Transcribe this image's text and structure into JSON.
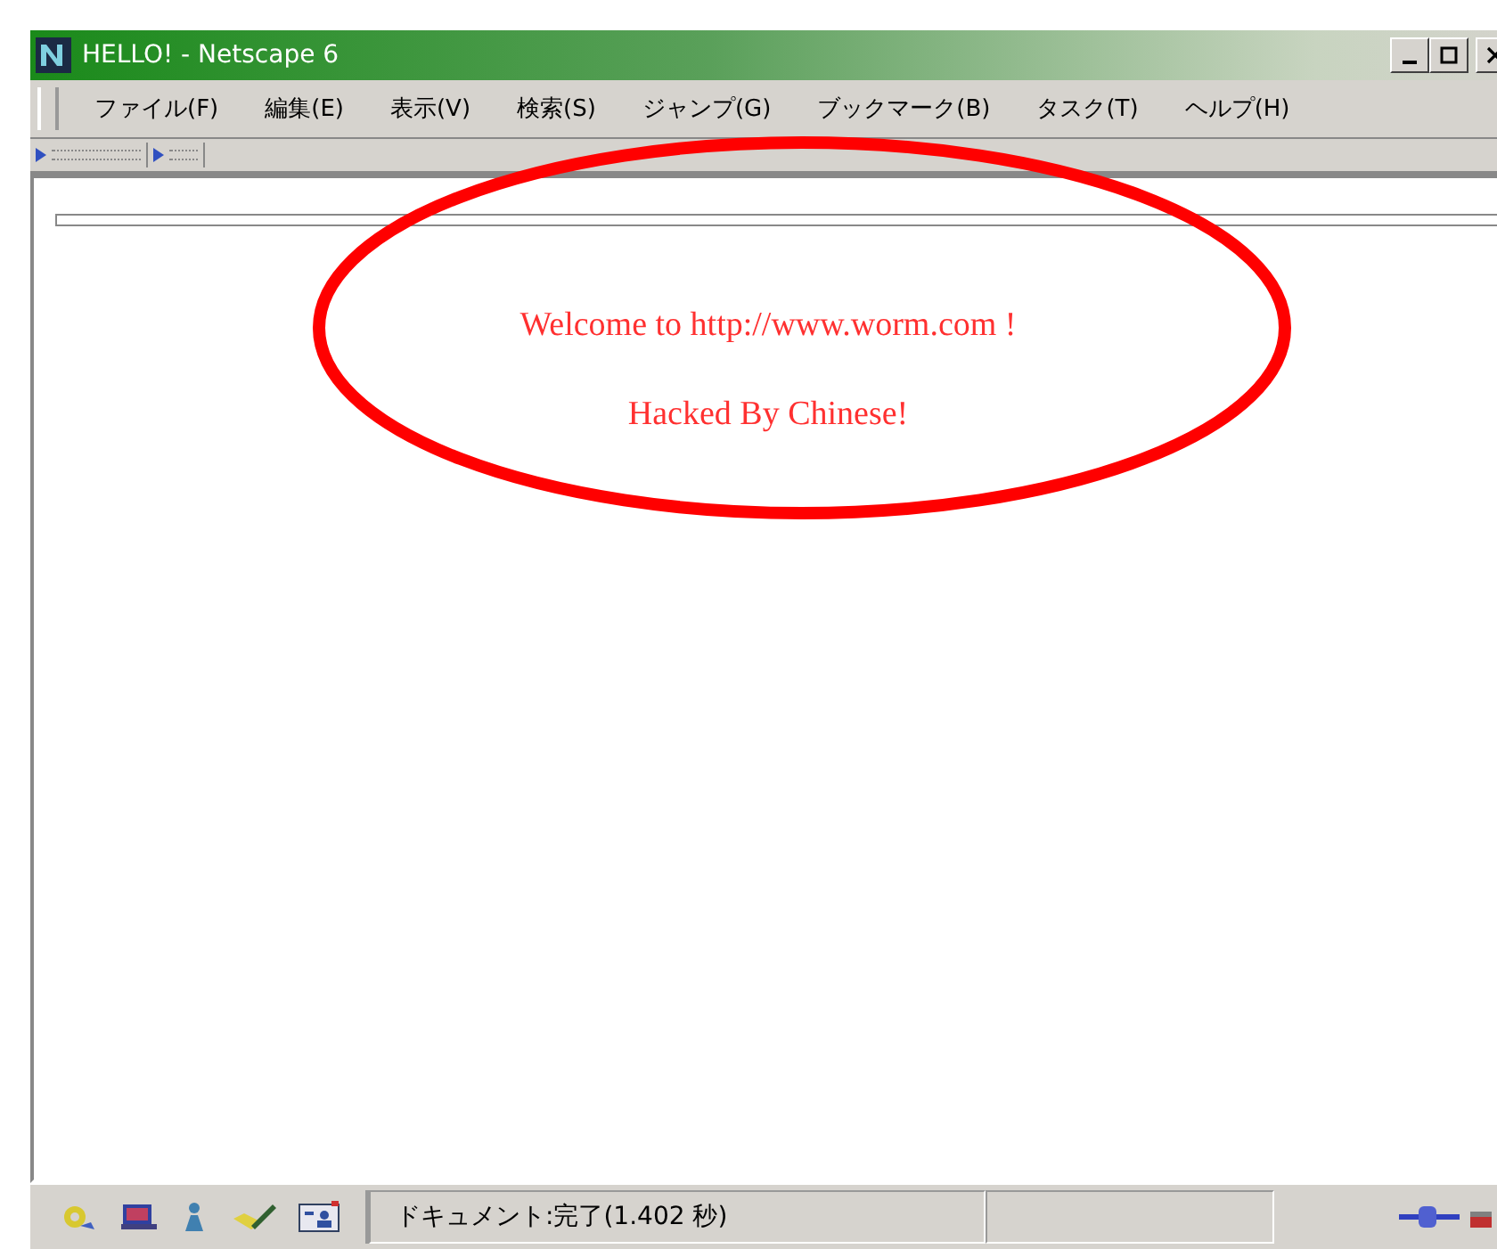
{
  "window": {
    "title": "HELLO! - Netscape 6"
  },
  "menu": [
    "ファイル(F)",
    "編集(E)",
    "表示(V)",
    "検索(S)",
    "ジャンプ(G)",
    "ブックマーク(B)",
    "タスク(T)",
    "ヘルプ(H)"
  ],
  "page": {
    "lines": [
      "Welcome to http://www.worm.com !",
      "Hacked By Chinese!"
    ]
  },
  "annotation": {
    "kind": "ellipse"
  },
  "status_bar": {
    "text": "ドキュメント:完了(1.402 秒)"
  }
}
